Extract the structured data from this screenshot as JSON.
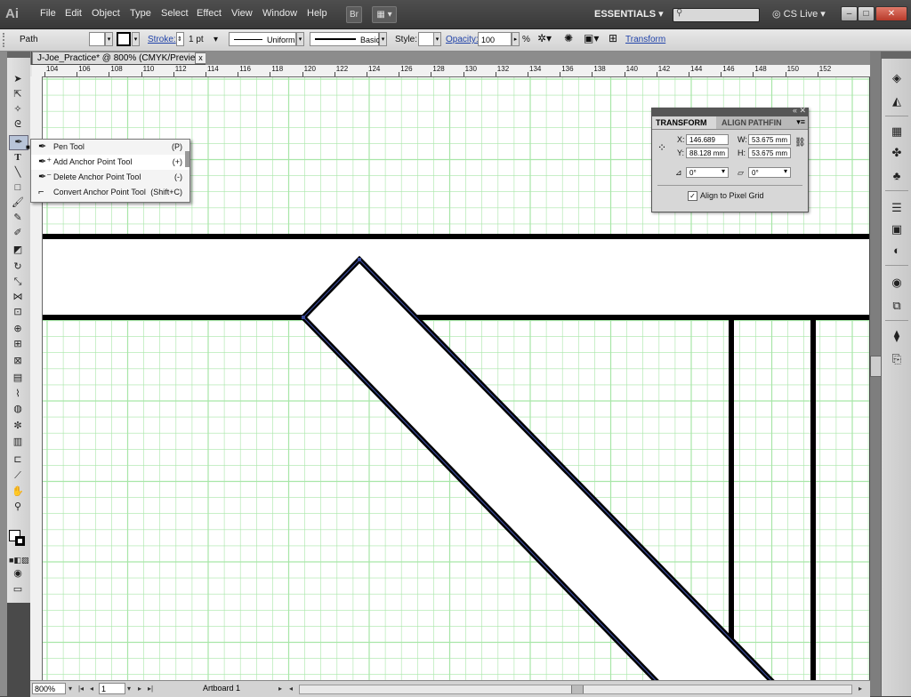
{
  "app": {
    "logo": "Ai"
  },
  "menu": [
    "File",
    "Edit",
    "Object",
    "Type",
    "Select",
    "Effect",
    "View",
    "Window",
    "Help"
  ],
  "header": {
    "bridge": "Br",
    "workspace": "ESSENTIALS",
    "cslive": "CS Live"
  },
  "window_buttons": [
    "–",
    "□",
    "✕"
  ],
  "control": {
    "selection": "Path",
    "stroke_label": "Stroke:",
    "stroke_weight": "1 pt",
    "profile": "Uniform",
    "brush": "Basic",
    "style_label": "Style:",
    "opacity_label": "Opacity:",
    "opacity_value": "100",
    "percent": "%",
    "transform_link": "Transform"
  },
  "document": {
    "tab_title": "J-Joe_Practice* @ 800% (CMYK/Preview)",
    "close": "x"
  },
  "ruler": {
    "h_ticks": [
      "104",
      "106",
      "108",
      "110",
      "112",
      "114",
      "116",
      "118",
      "120",
      "122",
      "124",
      "126",
      "128",
      "130",
      "132",
      "134",
      "136",
      "138",
      "140",
      "142",
      "144",
      "146",
      "148",
      "150",
      "152"
    ]
  },
  "pen_menu": [
    {
      "label": "Pen Tool",
      "shortcut": "(P)"
    },
    {
      "label": "Add Anchor Point Tool",
      "shortcut": "(+)"
    },
    {
      "label": "Delete Anchor Point Tool",
      "shortcut": "(-)"
    },
    {
      "label": "Convert Anchor Point Tool",
      "shortcut": "(Shift+C)"
    }
  ],
  "transform_panel": {
    "tabs": [
      "TRANSFORM",
      "ALIGN",
      "PATHFIN"
    ],
    "x_label": "X:",
    "x": "146.689 mm",
    "y_label": "Y:",
    "y": "88.128 mm",
    "w_label": "W:",
    "w": "53.675 mm",
    "h_label": "H:",
    "h": "53.675 mm",
    "rotate": "0°",
    "shear": "0°",
    "align_pixel_grid": "Align to Pixel Grid"
  },
  "status": {
    "zoom": "800%",
    "page": "1",
    "artboard": "Artboard 1"
  },
  "colors": {
    "grid": "#a8e6a8",
    "selection": "#3a4a9a"
  }
}
